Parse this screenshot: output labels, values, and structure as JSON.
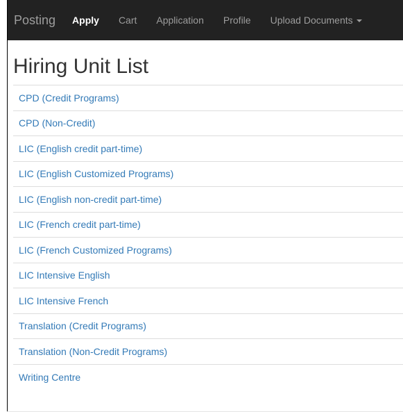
{
  "navbar": {
    "brand": "Posting",
    "items": [
      {
        "label": "Apply",
        "active": true
      },
      {
        "label": "Cart",
        "active": false
      },
      {
        "label": "Application",
        "active": false
      },
      {
        "label": "Profile",
        "active": false
      },
      {
        "label": "Upload Documents",
        "active": false,
        "dropdown": true
      }
    ],
    "colors": {
      "background": "#222222",
      "text": "#9d9d9d",
      "active_text": "#ffffff"
    }
  },
  "page": {
    "title": "Hiring Unit List"
  },
  "hiring_units": [
    {
      "label": "CPD (Credit Programs)"
    },
    {
      "label": "CPD (Non-Credit)"
    },
    {
      "label": "LIC (English credit part-time)"
    },
    {
      "label": "LIC (English Customized Programs)"
    },
    {
      "label": "LIC (English non-credit part-time)"
    },
    {
      "label": "LIC (French credit part-time)"
    },
    {
      "label": "LIC (French Customized Programs)"
    },
    {
      "label": "LIC Intensive English"
    },
    {
      "label": "LIC Intensive French"
    },
    {
      "label": "Translation (Credit Programs)"
    },
    {
      "label": "Translation (Non-Credit Programs)"
    },
    {
      "label": "Writing Centre"
    }
  ],
  "colors": {
    "link": "#337ab7",
    "title": "#333333",
    "divider": "#dddddd"
  }
}
